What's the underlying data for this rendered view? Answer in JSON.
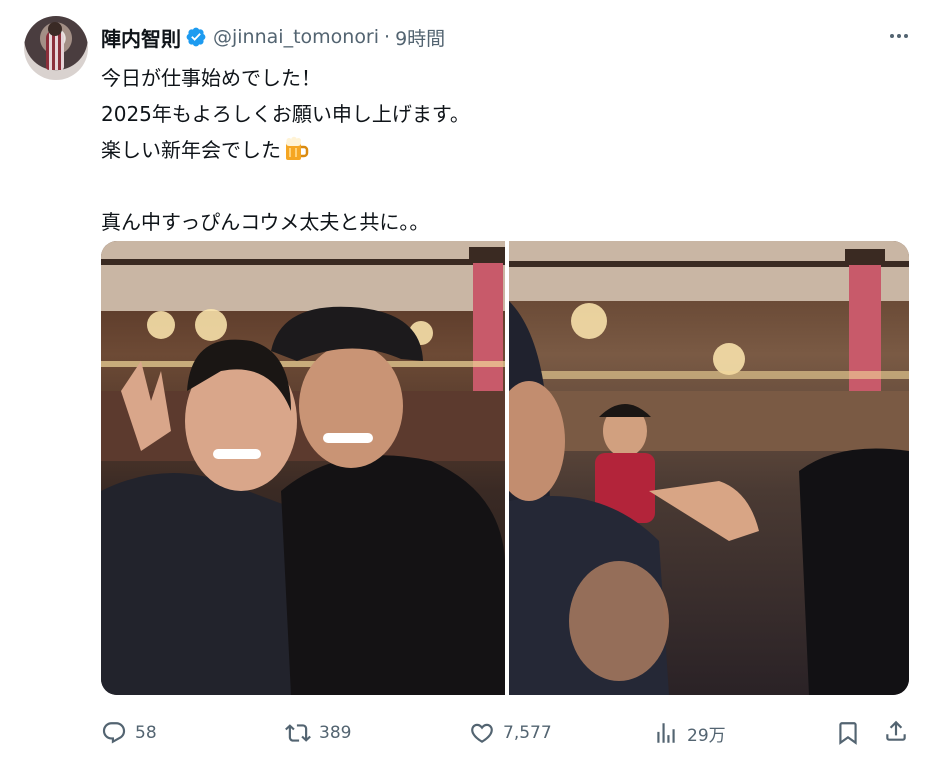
{
  "tweet": {
    "author_name": "陣内智則",
    "handle": "@jinnai_tomonori",
    "separator": "·",
    "time": "9時間",
    "lines": [
      "今日が仕事始めでした！",
      "2025年もよろしくお願い申し上げます。",
      "楽しい新年会でした",
      "",
      "真ん中すっぴんコウメ太夫と共に。。"
    ],
    "line3_emoji": "beer-mug-icon"
  },
  "actions": {
    "replies": "58",
    "reposts": "389",
    "likes": "7,577",
    "views": "29万"
  },
  "colors": {
    "text": "#0f1419",
    "secondary": "#536471",
    "verified": "#1d9bf0"
  }
}
